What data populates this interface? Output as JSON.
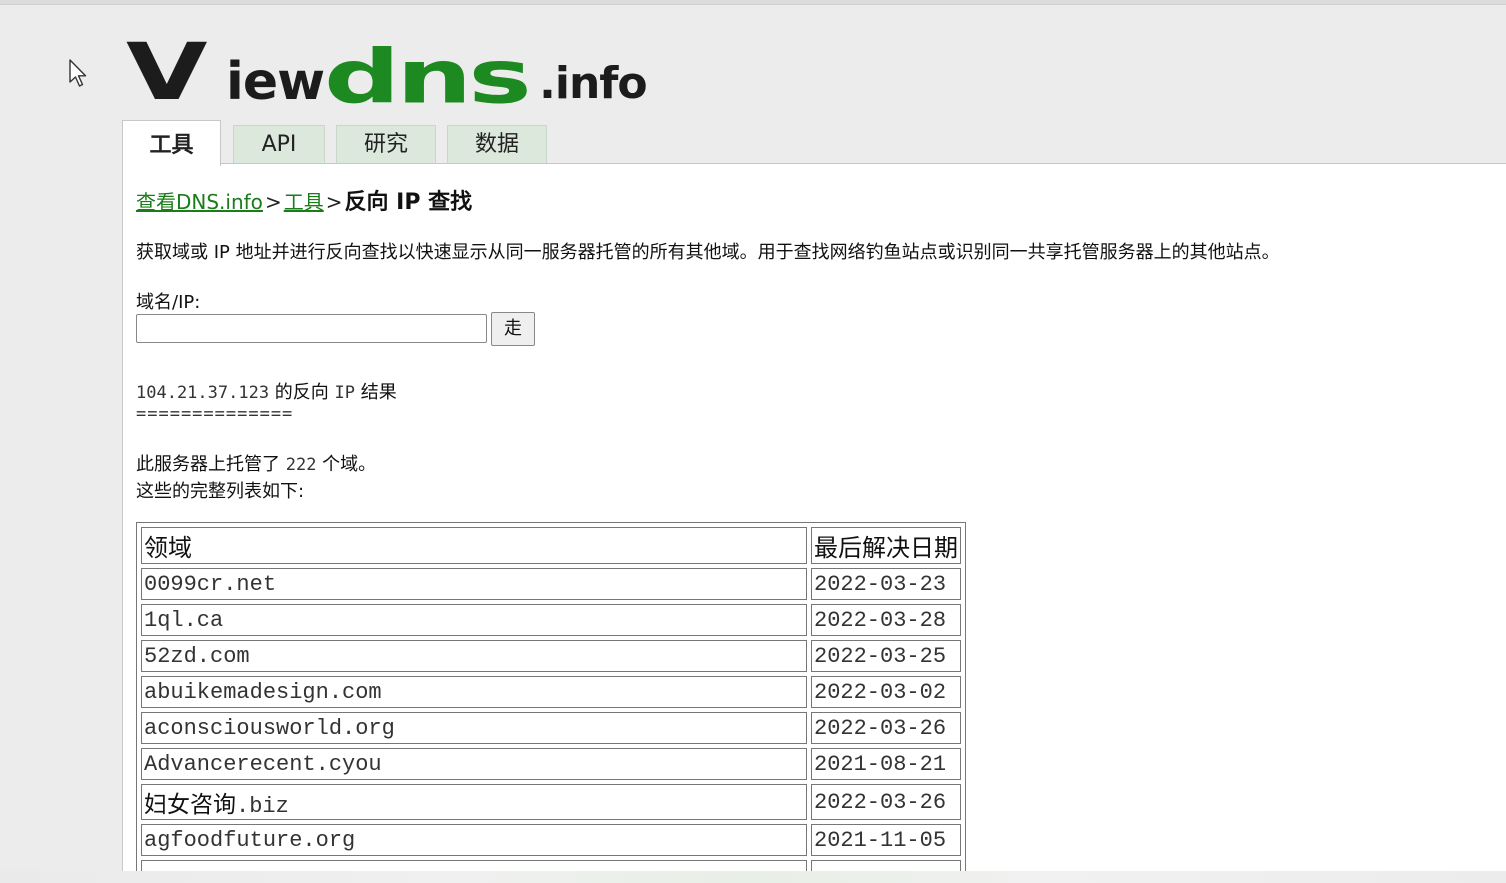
{
  "logo": {
    "part1": "V",
    "part2": "iew",
    "part3": "dns",
    "part4": ".info"
  },
  "tabs": [
    {
      "label": "工具"
    },
    {
      "label": "API"
    },
    {
      "label": "研究"
    },
    {
      "label": "数据"
    }
  ],
  "breadcrumb": {
    "home": "查看DNS.info",
    "sep1": ">",
    "tools": "工具",
    "sep2": ">",
    "current": "反向 IP 查找"
  },
  "description": "获取域或 IP 地址并进行反向查找以快速显示从同一服务器托管的所有其他域。用于查找网络钓鱼站点或识别同一共享托管服务器上的其他站点。",
  "form": {
    "label": "域名/IP:",
    "value": "",
    "go_label": "走"
  },
  "result": {
    "ip": "104.21.37.123",
    "head_mid": " 的反向 ",
    "head_ip_word": "IP",
    "head_suffix": " 结果",
    "rule": "==============",
    "count_prefix": "此服务器上托管了 ",
    "count": "222",
    "count_suffix": " 个域。",
    "list_note": "这些的完整列表如下:"
  },
  "table": {
    "headers": {
      "domain": "领域",
      "date": "最后解决日期"
    },
    "rows": [
      {
        "domain": "0099cr.net",
        "date": "2022-03-23"
      },
      {
        "domain": "1ql.ca",
        "date": "2022-03-28"
      },
      {
        "domain": "52zd.com",
        "date": "2022-03-25"
      },
      {
        "domain": "abuikemadesign.com",
        "date": "2022-03-02"
      },
      {
        "domain": "aconsciousworld.org",
        "date": "2022-03-26"
      },
      {
        "domain": "Advancerecent.cyou",
        "date": "2021-08-21"
      },
      {
        "domain_cn": "妇女咨询",
        "domain_tld": ".biz",
        "date": "2022-03-26"
      },
      {
        "domain": "agfoodfuture.org",
        "date": "2021-11-05"
      },
      {
        "domain": "",
        "date": ""
      }
    ]
  }
}
